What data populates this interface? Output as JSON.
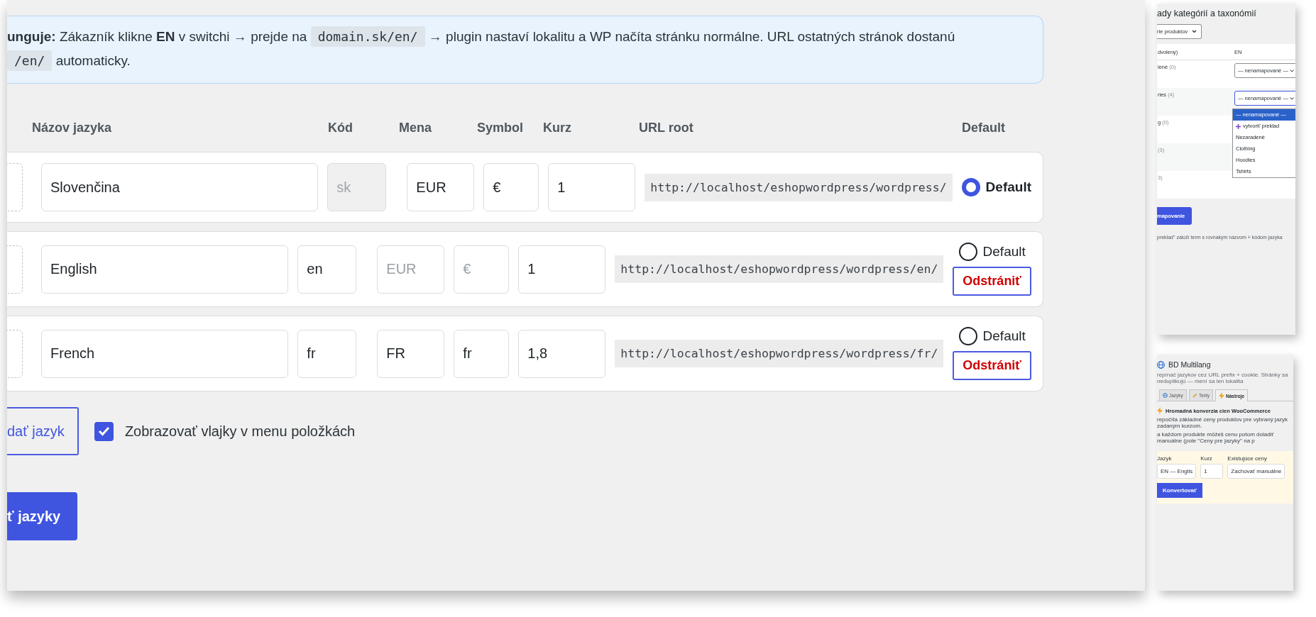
{
  "main": {
    "info": {
      "segments": [
        {
          "kind": "text",
          "text": "**unguje:** Zákazník klikne **EN** v switchi → prejde na "
        },
        {
          "kind": "code",
          "text": "domain.sk/en/"
        },
        {
          "kind": "text",
          "text": " → plugin nastaví lokalitu a WP načíta stránku normálne. URL ostatných stránok dostanú "
        },
        {
          "kind": "code",
          "text": "/en/"
        },
        {
          "kind": "text",
          "text": " automaticky."
        }
      ]
    },
    "columns": [
      "Názov jazyka",
      "Kód",
      "Mena",
      "Symbol",
      "Kurz",
      "URL root",
      "Default"
    ],
    "languages": [
      {
        "name": "Slovenčina",
        "code": {
          "value": "sk",
          "disabled": true
        },
        "currency": {
          "value": "EUR"
        },
        "symbol": {
          "value": "€"
        },
        "rate": "1",
        "url": "http://localhost/eshopwordpress/wordpress/",
        "default_label": "Default",
        "default": true
      },
      {
        "name": "English",
        "code": {
          "value": "en",
          "disabled": false
        },
        "currency": {
          "placeholder": "EUR"
        },
        "symbol": {
          "placeholder": "€"
        },
        "rate": "1",
        "url": "http://localhost/eshopwordpress/wordpress/en/",
        "default_label": "Default",
        "default": false,
        "remove": "Odstrániť"
      },
      {
        "name": "French",
        "code": {
          "value": "fr",
          "disabled": false
        },
        "currency": {
          "value": "FR"
        },
        "symbol": {
          "value": "fr"
        },
        "rate": "1,8",
        "url": "http://localhost/eshopwordpress/wordpress/fr/",
        "default_label": "Default",
        "default": false,
        "remove": "Odstrániť"
      }
    ],
    "add_button": "dať jazyk",
    "show_flags": {
      "label": "Zobrazovať vlajky v menu položkách",
      "checked": true
    },
    "save_button": "ť jazyky"
  },
  "taxonomy": {
    "title": "ady kategórií a taxonómií",
    "filter": "rie produktov",
    "columns": [
      "dvolený)",
      "EN"
    ],
    "rows": [
      {
        "name": "lené",
        "count": "(0)",
        "select": {
          "value": "— nenamapované —",
          "open": false
        }
      },
      {
        "name": "ries",
        "count": "(4)",
        "select": {
          "value": "— nenamapované —",
          "open": true
        }
      },
      {
        "name": "g",
        "count": "(0)"
      },
      {
        "count": "(3)"
      },
      {
        "count": "3)"
      }
    ],
    "dropdown": [
      {
        "label": "— nenamapované —",
        "kind": "plain",
        "selected": true
      },
      {
        "label": "vytvoriť preklad",
        "kind": "create",
        "selected": false
      },
      {
        "label": "Nezaradené",
        "kind": "plain",
        "selected": false
      },
      {
        "label": "Clothing",
        "kind": "plain",
        "selected": false
      },
      {
        "label": "Hoodies",
        "kind": "plain",
        "selected": false
      },
      {
        "label": "Tshirts",
        "kind": "plain",
        "selected": false
      }
    ],
    "button": "mapovanie",
    "note": "preklad\" založí term s rovnakým názvom + kódom jazyka"
  },
  "plugin": {
    "title": "BD Multilang",
    "subtitle": "repínač jazykov cez URL prefix + cookie. Stránky sa neduplikujú — mení sa len lokalita",
    "tabs": [
      {
        "label": "Jazyky",
        "selected": false
      },
      {
        "label": "Texty",
        "selected": false
      },
      {
        "label": "Nástroje",
        "selected": true
      }
    ],
    "heading": "Hromadná konverzia cien WooCommerce",
    "lines": [
      "repočíta základné ceny produktov pre vybraný jazyk zadaným kurzom.",
      "a každom produkte môžeš cenu potom doladiť manuálne (pole \"Ceny pre jazyky\" na p"
    ],
    "form": {
      "language_label": "Jazyk",
      "language": "EN — Englis",
      "rate_label": "Kurz",
      "rate": "1",
      "prices_label": "Existujúce ceny",
      "prices": "Zachovať manuálne",
      "button": "Konvertovať"
    }
  }
}
